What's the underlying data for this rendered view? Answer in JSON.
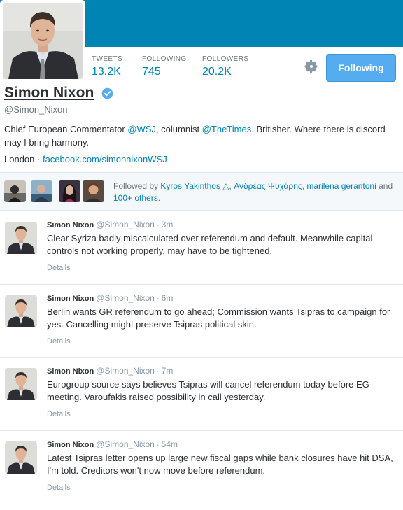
{
  "colors": {
    "brand": "#0084b4",
    "button": "#55acee",
    "link": "#0084b4"
  },
  "profile": {
    "name": "Simon Nixon",
    "screen_name": "@Simon_Nixon",
    "verified": true,
    "bio_pre": "Chief European Commentator ",
    "bio_link1": "@WSJ",
    "bio_mid": ", columnist ",
    "bio_link2": "@TheTimes",
    "bio_post": ". Britisher. Where there is discord may I bring harmony.",
    "location": "London",
    "separator": " · ",
    "website": "facebook.com/simonnixonWSJ"
  },
  "stats": {
    "tweets_label": "TWEETS",
    "tweets_value": "13.2K",
    "following_label": "FOLLOWING",
    "following_value": "745",
    "followers_label": "FOLLOWERS",
    "followers_value": "20.2K"
  },
  "actions": {
    "settings_icon": "gear-icon",
    "follow_label": "Following"
  },
  "followed_by": {
    "prefix": "Followed by ",
    "name1": "Kyros Yakinthos △",
    "comma1": ", ",
    "name2": "Ανδρέας Ψυχάρης",
    "comma2": ", ",
    "name3": "marilena gerantoni",
    "and": " and ",
    "others": "100+ others",
    "end": "."
  },
  "tweets": [
    {
      "name": "Simon Nixon",
      "handle": "@Simon_Nixon",
      "sep": " · ",
      "time": "3m",
      "text": "Clear Syriza badly miscalculated over referendum and default. Meanwhile capital controls not working properly, may have to be tightened.",
      "details": "Details"
    },
    {
      "name": "Simon Nixon",
      "handle": "@Simon_Nixon",
      "sep": " · ",
      "time": "6m",
      "text": "Berlin wants GR referendum to go ahead; Commission wants Tsipras to campaign for yes. Cancelling might preserve Tsipras political skin.",
      "details": "Details"
    },
    {
      "name": "Simon Nixon",
      "handle": "@Simon_Nixon",
      "sep": " · ",
      "time": "7m",
      "text": "Eurogroup source says believes Tsipras will cancel referendum today before EG meeting. Varoufakis raised possibility in call yesterday.",
      "details": "Details"
    },
    {
      "name": "Simon Nixon",
      "handle": "@Simon_Nixon",
      "sep": " · ",
      "time": "54m",
      "text": "Latest Tsipras letter opens up large new fiscal gaps while bank closures have hit DSA, I'm told. Creditors won't now move before referendum.",
      "details": "Details"
    }
  ]
}
